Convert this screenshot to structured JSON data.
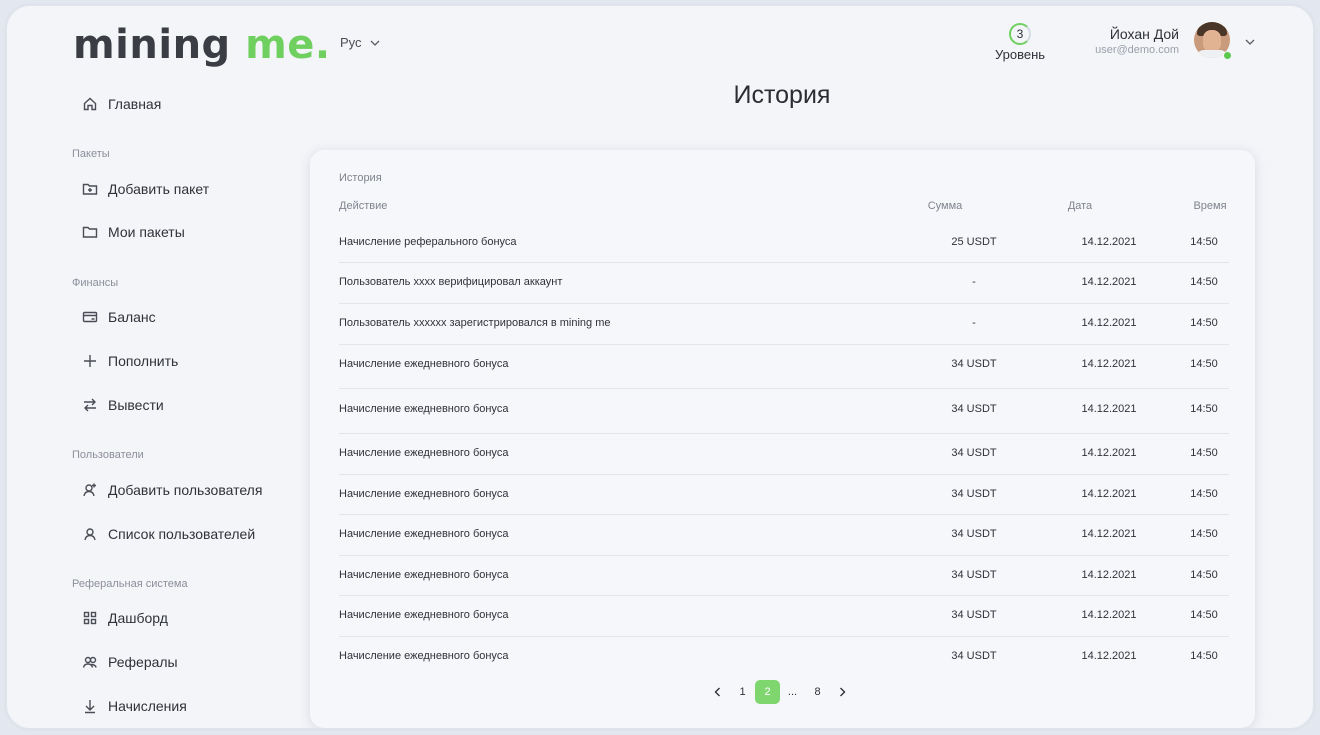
{
  "app": {
    "logo_part1": "mining",
    "logo_part2": "me."
  },
  "header": {
    "language": "Рус",
    "level_value": "3",
    "level_label": "Уровень",
    "user_name": "Йохан Дой",
    "user_email": "user@demo.com"
  },
  "sidebar": {
    "home": "Главная",
    "sections": {
      "packages": "Пакеты",
      "finance": "Финансы",
      "users": "Пользователи",
      "referral": "Реферальная система"
    },
    "items": {
      "add_package": "Добавить пакет",
      "my_packages": "Мои пакеты",
      "balance": "Баланс",
      "top_up": "Пополнить",
      "withdraw": "Вывести",
      "add_user": "Добавить пользователя",
      "user_list": "Список пользователей",
      "dashboard": "Дашборд",
      "referrals": "Рефералы",
      "accruals": "Начисления"
    }
  },
  "main": {
    "page_title": "История",
    "card_title": "История",
    "columns": {
      "action": "Действие",
      "sum": "Сумма",
      "date": "Дата",
      "time": "Время"
    },
    "rows": [
      {
        "action": "Начисление реферального бонуса",
        "sum": "25 USDT",
        "date": "14.12.2021",
        "time": "14:50"
      },
      {
        "action": "Пользователь xxxx  верифицировал аккаунт",
        "sum": "-",
        "date": "14.12.2021",
        "time": "14:50"
      },
      {
        "action": "Пользователь xxxxxx зарегистрировался в mining me",
        "sum": "-",
        "date": "14.12.2021",
        "time": "14:50"
      },
      {
        "action": "Начисление ежедневного бонуса",
        "sum": "34 USDT",
        "date": "14.12.2021",
        "time": "14:50"
      },
      {
        "action": "Начисление ежедневного бонуса",
        "sum": "34 USDT",
        "date": "14.12.2021",
        "time": "14:50"
      },
      {
        "action": "Начисление ежедневного бонуса",
        "sum": "34 USDT",
        "date": "14.12.2021",
        "time": "14:50"
      },
      {
        "action": "Начисление ежедневного бонуса",
        "sum": "34 USDT",
        "date": "14.12.2021",
        "time": "14:50"
      },
      {
        "action": "Начисление ежедневного бонуса",
        "sum": "34 USDT",
        "date": "14.12.2021",
        "time": "14:50"
      },
      {
        "action": "Начисление ежедневного бонуса",
        "sum": "34 USDT",
        "date": "14.12.2021",
        "time": "14:50"
      },
      {
        "action": "Начисление ежедневного бонуса",
        "sum": "34 USDT",
        "date": "14.12.2021",
        "time": "14:50"
      },
      {
        "action": "Начисление ежедневного бонуса",
        "sum": "34 USDT",
        "date": "14.12.2021",
        "time": "14:50"
      }
    ],
    "pagination": {
      "pages": [
        "1",
        "2",
        "...",
        "8"
      ],
      "current": "2"
    }
  },
  "colors": {
    "accent": "#6fcf5f",
    "pager_active": "#7fd66f",
    "online": "#5ac84c"
  }
}
